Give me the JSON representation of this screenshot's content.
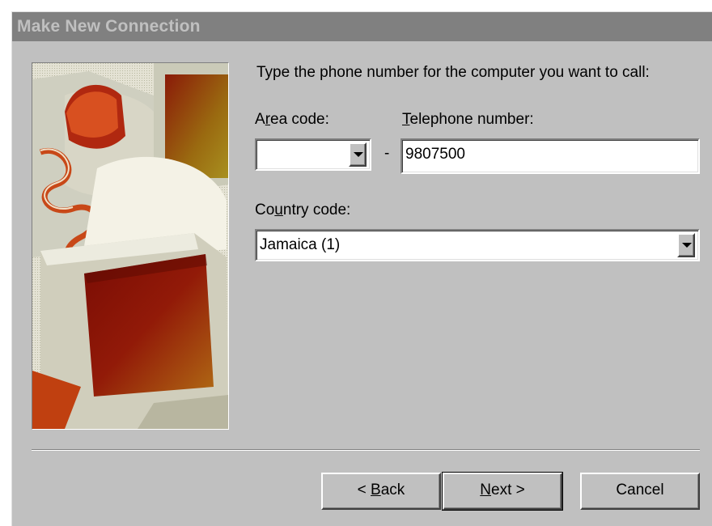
{
  "window": {
    "title": "Make New Connection"
  },
  "prompt": "Type the phone number for the computer you want to call:",
  "area_code": {
    "label_pre": "A",
    "label_mnemonic": "r",
    "label_post": "ea code:",
    "value": ""
  },
  "separator_dash": "-",
  "telephone": {
    "label_pre": "",
    "label_mnemonic": "T",
    "label_post": "elephone number:",
    "value": "9807500"
  },
  "country": {
    "label_pre": "Co",
    "label_mnemonic": "u",
    "label_post": "ntry code:",
    "value": "Jamaica (1)"
  },
  "buttons": {
    "back_pre": "< ",
    "back_mnemonic": "B",
    "back_post": "ack",
    "next_pre": "",
    "next_mnemonic": "N",
    "next_post": "ext >",
    "cancel": "Cancel"
  },
  "icons": {
    "dropdown": "chevron-down-icon",
    "wizard_image": "computer-phone-illustration"
  },
  "colors": {
    "face": "#c0c0c0",
    "title_bar": "#808080",
    "title_text": "#c0c0c0"
  }
}
